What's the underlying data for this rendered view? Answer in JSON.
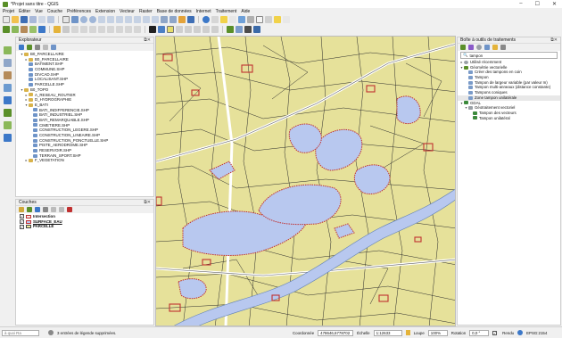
{
  "window": {
    "title": "*Projet sans titre - QGIS",
    "controls": [
      "–",
      "☐",
      "✕"
    ]
  },
  "menu": [
    "Projet",
    "Éditer",
    "Vue",
    "Couche",
    "Préférences",
    "Extension",
    "Vecteur",
    "Raster",
    "Base de données",
    "Internet",
    "Traitement",
    "Aide"
  ],
  "explorer": {
    "title": "Explorateur",
    "rows": [
      {
        "indent": 1,
        "arrow": "▾",
        "icon": "folder",
        "label": "B0_PARCELLAIRE"
      },
      {
        "indent": 2,
        "arrow": "▸",
        "icon": "folder",
        "label": "B0_PARCELLAIRE"
      },
      {
        "indent": 2,
        "arrow": "",
        "icon": "file",
        "label": "BATIMENT.SHP"
      },
      {
        "indent": 2,
        "arrow": "",
        "icon": "file",
        "label": "COMMUNE.SHP"
      },
      {
        "indent": 2,
        "arrow": "",
        "icon": "file",
        "label": "DIVCAD.SHP"
      },
      {
        "indent": 2,
        "arrow": "",
        "icon": "file",
        "label": "LOCALISANT.SHP"
      },
      {
        "indent": 2,
        "arrow": "",
        "icon": "file",
        "label": "PARCELLE.SHP"
      },
      {
        "indent": 1,
        "arrow": "▾",
        "icon": "folder",
        "label": "B0_TOPO"
      },
      {
        "indent": 2,
        "arrow": "▸",
        "icon": "folder",
        "label": "A_RESEAU_ROUTIER"
      },
      {
        "indent": 2,
        "arrow": "▸",
        "icon": "folder",
        "label": "D_HYDROGRAPHIE"
      },
      {
        "indent": 2,
        "arrow": "▾",
        "icon": "folder",
        "label": "E_BATI"
      },
      {
        "indent": 3,
        "arrow": "",
        "icon": "file",
        "label": "BATI_INDIFFERENCIE.SHP"
      },
      {
        "indent": 3,
        "arrow": "",
        "icon": "file",
        "label": "BATI_INDUSTRIEL.SHP"
      },
      {
        "indent": 3,
        "arrow": "",
        "icon": "file",
        "label": "BATI_REMARQUABLE.SHP"
      },
      {
        "indent": 3,
        "arrow": "",
        "icon": "file",
        "label": "CIMETIERE.SHP"
      },
      {
        "indent": 3,
        "arrow": "",
        "icon": "file",
        "label": "CONSTRUCTION_LEGERE.SHP"
      },
      {
        "indent": 3,
        "arrow": "",
        "icon": "file",
        "label": "CONSTRUCTION_LINEAIRE.SHP"
      },
      {
        "indent": 3,
        "arrow": "",
        "icon": "file",
        "label": "CONSTRUCTION_PONCTUELLE.SHP"
      },
      {
        "indent": 3,
        "arrow": "",
        "icon": "file",
        "label": "PISTE_AERODROME.SHP"
      },
      {
        "indent": 3,
        "arrow": "",
        "icon": "file",
        "label": "RESERVOIR.SHP"
      },
      {
        "indent": 3,
        "arrow": "",
        "icon": "file",
        "label": "TERRAIN_SPORT.SHP"
      },
      {
        "indent": 2,
        "arrow": "▸",
        "icon": "folder",
        "label": "F_VEGETATION"
      }
    ]
  },
  "layers": {
    "title": "Couches",
    "items": [
      {
        "label": "Intersection",
        "checked": true,
        "swatch": "#f3e4e4",
        "border": "#c03030"
      },
      {
        "label": "SURFACE_EAU",
        "checked": true,
        "swatch": "#b8c8ef",
        "border": "#c03030",
        "underline": true
      },
      {
        "label": "PARCELLE",
        "checked": true,
        "swatch": "#f0ea9c",
        "border": "#444444"
      }
    ]
  },
  "toolbox": {
    "title": "Boîte à outils de traitements",
    "search_value": "tampon",
    "rows": [
      {
        "indent": 1,
        "arrow": "▸",
        "label": "Utilisé récemment",
        "icon": "#9aa0a6"
      },
      {
        "indent": 1,
        "arrow": "▾",
        "label": "Géométrie vectorielle",
        "icon": "#5a8f29"
      },
      {
        "indent": 2,
        "arrow": "",
        "label": "Créer des tampons en coin",
        "icon": "#7a9bc9"
      },
      {
        "indent": 2,
        "arrow": "",
        "label": "Tampon",
        "icon": "#7a9bc9"
      },
      {
        "indent": 2,
        "arrow": "",
        "label": "Tampon de largeur variable (par valeur m)",
        "icon": "#7a9bc9"
      },
      {
        "indent": 2,
        "arrow": "",
        "label": "Tampon multi-anneaux (distance constante)",
        "icon": "#7a9bc9"
      },
      {
        "indent": 2,
        "arrow": "",
        "label": "Tampons coniques",
        "icon": "#7a9bc9"
      },
      {
        "indent": 2,
        "arrow": "",
        "label": "Zone tampon unilatérale",
        "icon": "#7a9bc9"
      },
      {
        "indent": 1,
        "arrow": "▾",
        "label": "GDAL",
        "icon": "#3b8a3b"
      },
      {
        "indent": 2,
        "arrow": "▾",
        "label": "Géotraitement vectoriel",
        "icon": "#9aa0a6"
      },
      {
        "indent": 3,
        "arrow": "",
        "label": "Tampon des vecteurs",
        "icon": "#3b8a3b"
      },
      {
        "indent": 3,
        "arrow": "",
        "label": "Tampon unilatéral",
        "icon": "#3b8a3b"
      }
    ]
  },
  "status": {
    "search_placeholder": "à quoi Ra",
    "message": "3 entrées de légende supprimées.",
    "coord_label": "Coordonnée",
    "coord_value": "478646,6778702",
    "scale_label": "Échelle",
    "scale_value": "1:12633",
    "loupe_label": "Loupe",
    "loupe_value": "100%",
    "rotation_label": "Rotation",
    "rotation_value": "0,0 °",
    "render_label": "Rendu",
    "crs": "EPSG:2154"
  },
  "colors": {
    "parcel_fill": "#e6e19a",
    "water_fill": "#b8c8ef",
    "intersection_outline": "#c03030"
  }
}
